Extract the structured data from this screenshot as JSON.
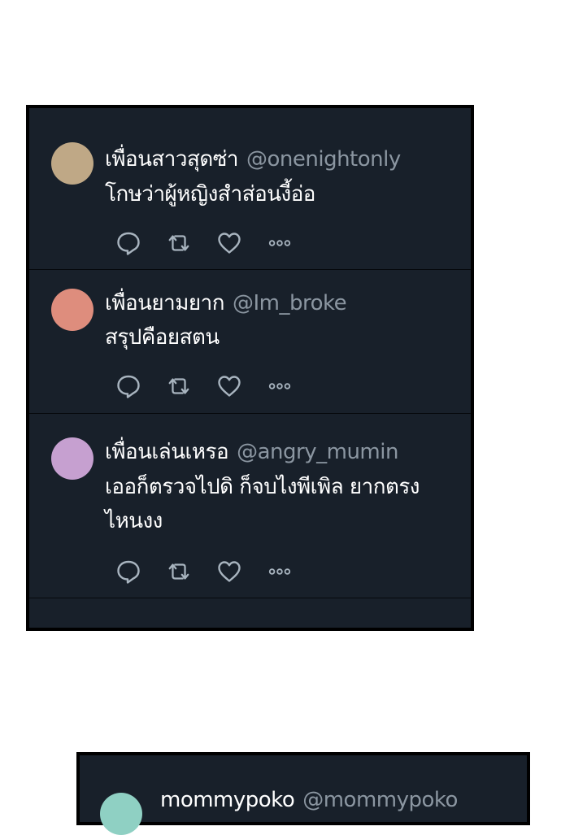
{
  "tweets": [
    {
      "name": "เพื่อนสาวสุดซ่า",
      "handle": "@onenightonly",
      "text": "โกษว่าผู้หญิงสำส่อนงี้อ่อ",
      "avatar_color": "#bfa886"
    },
    {
      "name": "เพื่อนยามยาก",
      "handle": "@Im_broke",
      "text": "สรุปคือยสตน",
      "avatar_color": "#de8d7d"
    },
    {
      "name": "เพื่อนเล่นเหรอ",
      "handle": "@angry_mumin",
      "text": "เออก็ตรวจไปดิ ก็จบไงพีเพิล ยากตรงไหนงง",
      "avatar_color": "#c6a0d0"
    },
    {
      "name": "mommypoko",
      "handle": "@mommypoko",
      "text": "",
      "avatar_color": "#8fd0c3"
    }
  ],
  "icons": [
    "reply-icon",
    "retweet-icon",
    "like-icon",
    "more-icon"
  ],
  "colors": {
    "panel_bg": "#18202a",
    "name": "#ffffff",
    "handle": "#8b96a1",
    "icon": "#a8b4bf"
  }
}
